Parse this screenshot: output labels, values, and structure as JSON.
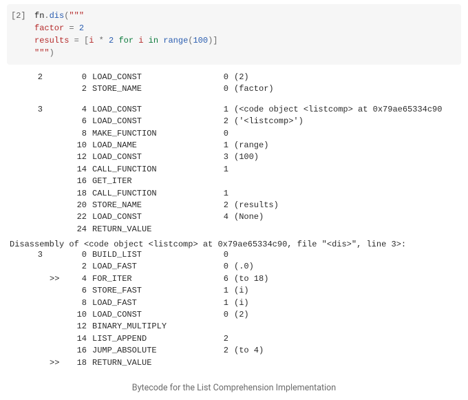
{
  "cell": {
    "prompt": "[2]",
    "code_tokens": [
      [
        [
          "fn",
          "dis"
        ],
        [
          ".",
          "op"
        ],
        [
          "dis",
          "fn"
        ],
        [
          "(",
          "op"
        ],
        [
          "\"\"\"",
          "str"
        ]
      ],
      [
        [
          "factor ",
          "name"
        ],
        [
          "= ",
          "op"
        ],
        [
          "2",
          "num"
        ]
      ],
      [
        [
          "results ",
          "name"
        ],
        [
          "= ",
          "op"
        ],
        [
          "[",
          "op"
        ],
        [
          "i ",
          "name"
        ],
        [
          "* ",
          "op"
        ],
        [
          "2",
          "num"
        ],
        [
          " ",
          "op"
        ],
        [
          "for",
          "kw"
        ],
        [
          " i ",
          "name"
        ],
        [
          "in",
          "kw"
        ],
        [
          " ",
          "op"
        ],
        [
          "range",
          "fn"
        ],
        [
          "(",
          "op"
        ],
        [
          "100",
          "num"
        ],
        [
          ")",
          "op"
        ],
        [
          "]",
          "op"
        ]
      ],
      [
        [
          "\"\"\"",
          "str"
        ],
        [
          ")",
          "op"
        ]
      ]
    ]
  },
  "blocks": [
    {
      "rows": [
        {
          "line": "2",
          "mark": "",
          "offset": "0",
          "opcode": "LOAD_CONST",
          "arg": "0",
          "argval": "(2)"
        },
        {
          "line": "",
          "mark": "",
          "offset": "2",
          "opcode": "STORE_NAME",
          "arg": "0",
          "argval": "(factor)"
        }
      ]
    },
    {
      "rows": [
        {
          "line": "3",
          "mark": "",
          "offset": "4",
          "opcode": "LOAD_CONST",
          "arg": "1",
          "argval": "(<code object <listcomp> at 0x79ae65334c90"
        },
        {
          "line": "",
          "mark": "",
          "offset": "6",
          "opcode": "LOAD_CONST",
          "arg": "2",
          "argval": "('<listcomp>')"
        },
        {
          "line": "",
          "mark": "",
          "offset": "8",
          "opcode": "MAKE_FUNCTION",
          "arg": "0",
          "argval": ""
        },
        {
          "line": "",
          "mark": "",
          "offset": "10",
          "opcode": "LOAD_NAME",
          "arg": "1",
          "argval": "(range)"
        },
        {
          "line": "",
          "mark": "",
          "offset": "12",
          "opcode": "LOAD_CONST",
          "arg": "3",
          "argval": "(100)"
        },
        {
          "line": "",
          "mark": "",
          "offset": "14",
          "opcode": "CALL_FUNCTION",
          "arg": "1",
          "argval": ""
        },
        {
          "line": "",
          "mark": "",
          "offset": "16",
          "opcode": "GET_ITER",
          "arg": "",
          "argval": ""
        },
        {
          "line": "",
          "mark": "",
          "offset": "18",
          "opcode": "CALL_FUNCTION",
          "arg": "1",
          "argval": ""
        },
        {
          "line": "",
          "mark": "",
          "offset": "20",
          "opcode": "STORE_NAME",
          "arg": "2",
          "argval": "(results)"
        },
        {
          "line": "",
          "mark": "",
          "offset": "22",
          "opcode": "LOAD_CONST",
          "arg": "4",
          "argval": "(None)"
        },
        {
          "line": "",
          "mark": "",
          "offset": "24",
          "opcode": "RETURN_VALUE",
          "arg": "",
          "argval": ""
        }
      ]
    }
  ],
  "disasm_header": "Disassembly of <code object <listcomp> at 0x79ae65334c90, file \"<dis>\", line 3>:",
  "disasm_rows": [
    {
      "line": "3",
      "mark": "",
      "offset": "0",
      "opcode": "BUILD_LIST",
      "arg": "0",
      "argval": ""
    },
    {
      "line": "",
      "mark": "",
      "offset": "2",
      "opcode": "LOAD_FAST",
      "arg": "0",
      "argval": "(.0)"
    },
    {
      "line": "",
      "mark": ">>",
      "offset": "4",
      "opcode": "FOR_ITER",
      "arg": "6",
      "argval": "(to 18)"
    },
    {
      "line": "",
      "mark": "",
      "offset": "6",
      "opcode": "STORE_FAST",
      "arg": "1",
      "argval": "(i)"
    },
    {
      "line": "",
      "mark": "",
      "offset": "8",
      "opcode": "LOAD_FAST",
      "arg": "1",
      "argval": "(i)"
    },
    {
      "line": "",
      "mark": "",
      "offset": "10",
      "opcode": "LOAD_CONST",
      "arg": "0",
      "argval": "(2)"
    },
    {
      "line": "",
      "mark": "",
      "offset": "12",
      "opcode": "BINARY_MULTIPLY",
      "arg": "",
      "argval": ""
    },
    {
      "line": "",
      "mark": "",
      "offset": "14",
      "opcode": "LIST_APPEND",
      "arg": "2",
      "argval": ""
    },
    {
      "line": "",
      "mark": "",
      "offset": "16",
      "opcode": "JUMP_ABSOLUTE",
      "arg": "2",
      "argval": "(to 4)"
    },
    {
      "line": "",
      "mark": ">>",
      "offset": "18",
      "opcode": "RETURN_VALUE",
      "arg": "",
      "argval": ""
    }
  ],
  "caption": "Bytecode for the List Comprehension Implementation"
}
